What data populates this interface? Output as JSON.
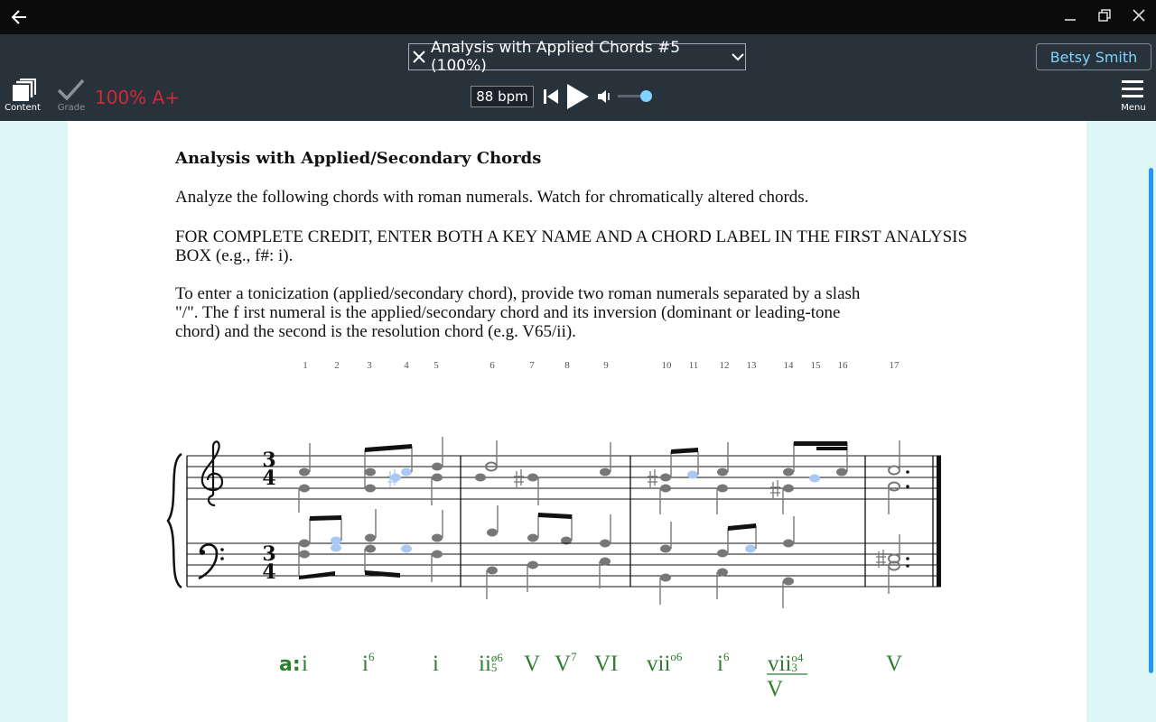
{
  "window": {
    "back_icon": "arrow-left-icon",
    "minimize_icon": "minimize-icon",
    "restore_icon": "restore-icon",
    "close_icon": "close-icon"
  },
  "toolbar": {
    "content_label": "Content",
    "grade_label": "Grade",
    "score": "100% A+",
    "document_title": "Analysis with Applied Chords #5 (100%)",
    "user_name": "Betsy Smith",
    "tempo": "88 bpm",
    "menu_label": "Menu",
    "accent_color": "#7fd3ff",
    "score_color": "#d2283a"
  },
  "document": {
    "heading": "Analysis with Applied/Secondary Chords",
    "instruction_1": "Analyze the following chords with roman numerals. Watch for chromatically altered chords.",
    "instruction_2_line1": "FOR COMPLETE CREDIT, ENTER BOTH A KEY NAME AND A CHORD LABEL IN THE FIRST ANALYSIS",
    "instruction_2_line2": "BOX (e.g., f#: i).",
    "instruction_3_line1": "To enter a tonicization (applied/secondary chord), provide two roman numerals separated by a slash",
    "instruction_3_line2": "\"/\". The f irst numeral is the applied/secondary chord and its inversion (dominant or leading-tone",
    "instruction_3_line3": "chord) and the second is the resolution chord (e.g. V65/ii)."
  },
  "score": {
    "treble_time_top": "3",
    "treble_time_bottom": "4",
    "bass_time_top": "3",
    "bass_time_bottom": "4",
    "measure_numbers": [
      "1",
      "2",
      "3",
      "4",
      "5",
      "6",
      "7",
      "8",
      "9",
      "10",
      "11",
      "12",
      "13",
      "14",
      "15",
      "16",
      "17"
    ]
  },
  "analysis": {
    "key": "a:",
    "chords": [
      {
        "base": "i",
        "sup": "",
        "sub": ""
      },
      {
        "base": "i",
        "sup": "6",
        "sub": ""
      },
      {
        "base": "i",
        "sup": "",
        "sub": ""
      },
      {
        "base": "ii",
        "sup": "ø6",
        "sub": "5"
      },
      {
        "base": "V",
        "sup": "",
        "sub": ""
      },
      {
        "base": "V",
        "sup": "7",
        "sub": ""
      },
      {
        "base": "VI",
        "sup": "",
        "sub": ""
      },
      {
        "base": "vii",
        "sup": "o6",
        "sub": ""
      },
      {
        "base": "i",
        "sup": "6",
        "sub": ""
      },
      {
        "base": "vii",
        "sup": "o4",
        "sub": "3"
      },
      {
        "base": "V",
        "sup": "",
        "sub": ""
      }
    ],
    "applied_target": "V",
    "color": "#2f7d2f"
  }
}
